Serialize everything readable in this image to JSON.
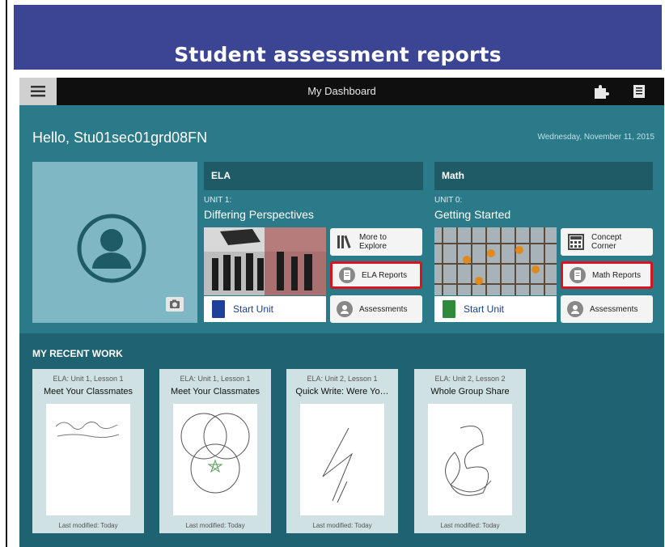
{
  "banner": {
    "title": "Student assessment reports"
  },
  "topbar": {
    "title": "My Dashboard",
    "menu_icon": "hamburger-icon",
    "right_icons": [
      "puzzle-icon",
      "notebook-icon"
    ]
  },
  "greeting": "Hello, Stu01sec01grd08FN",
  "date": "Wednesday, November 11, 2015",
  "subjects": [
    {
      "header": "ELA",
      "unit_number": "UNIT 1:",
      "unit_title": "Differing Perspectives",
      "start_label": "Start Unit",
      "book_color": "#1f3f9a",
      "buttons": [
        {
          "label": "More to Explore",
          "icon": "books-icon"
        },
        {
          "label": "ELA Reports",
          "icon": "report-icon",
          "highlighted": true
        },
        {
          "label": "Assessments",
          "icon": "person-icon"
        }
      ]
    },
    {
      "header": "Math",
      "unit_number": "UNIT 0:",
      "unit_title": "Getting Started",
      "start_label": "Start Unit",
      "book_color": "#2f8a3a",
      "buttons": [
        {
          "label": "Concept Corner",
          "icon": "calculator-icon"
        },
        {
          "label": "Math Reports",
          "icon": "report-icon",
          "highlighted": true
        },
        {
          "label": "Assessments",
          "icon": "person-icon"
        }
      ]
    }
  ],
  "recent": {
    "title": "MY RECENT WORK",
    "cards": [
      {
        "subtitle": "ELA: Unit 1, Lesson 1",
        "title": "Meet Your Classmates",
        "footer": "Last modified: Today"
      },
      {
        "subtitle": "ELA: Unit 1, Lesson 1",
        "title": "Meet Your Classmates",
        "footer": "Last modified: Today"
      },
      {
        "subtitle": "ELA: Unit 2, Lesson 1",
        "title": "Quick Write: Were Yo…",
        "footer": "Last modified: Today"
      },
      {
        "subtitle": "ELA: Unit 2, Lesson 2",
        "title": "Whole Group Share",
        "footer": "Last modified: Today"
      }
    ]
  },
  "colors": {
    "banner": "#3c4593",
    "app_bg": "#2b7a89",
    "highlight": "#d9141f"
  }
}
